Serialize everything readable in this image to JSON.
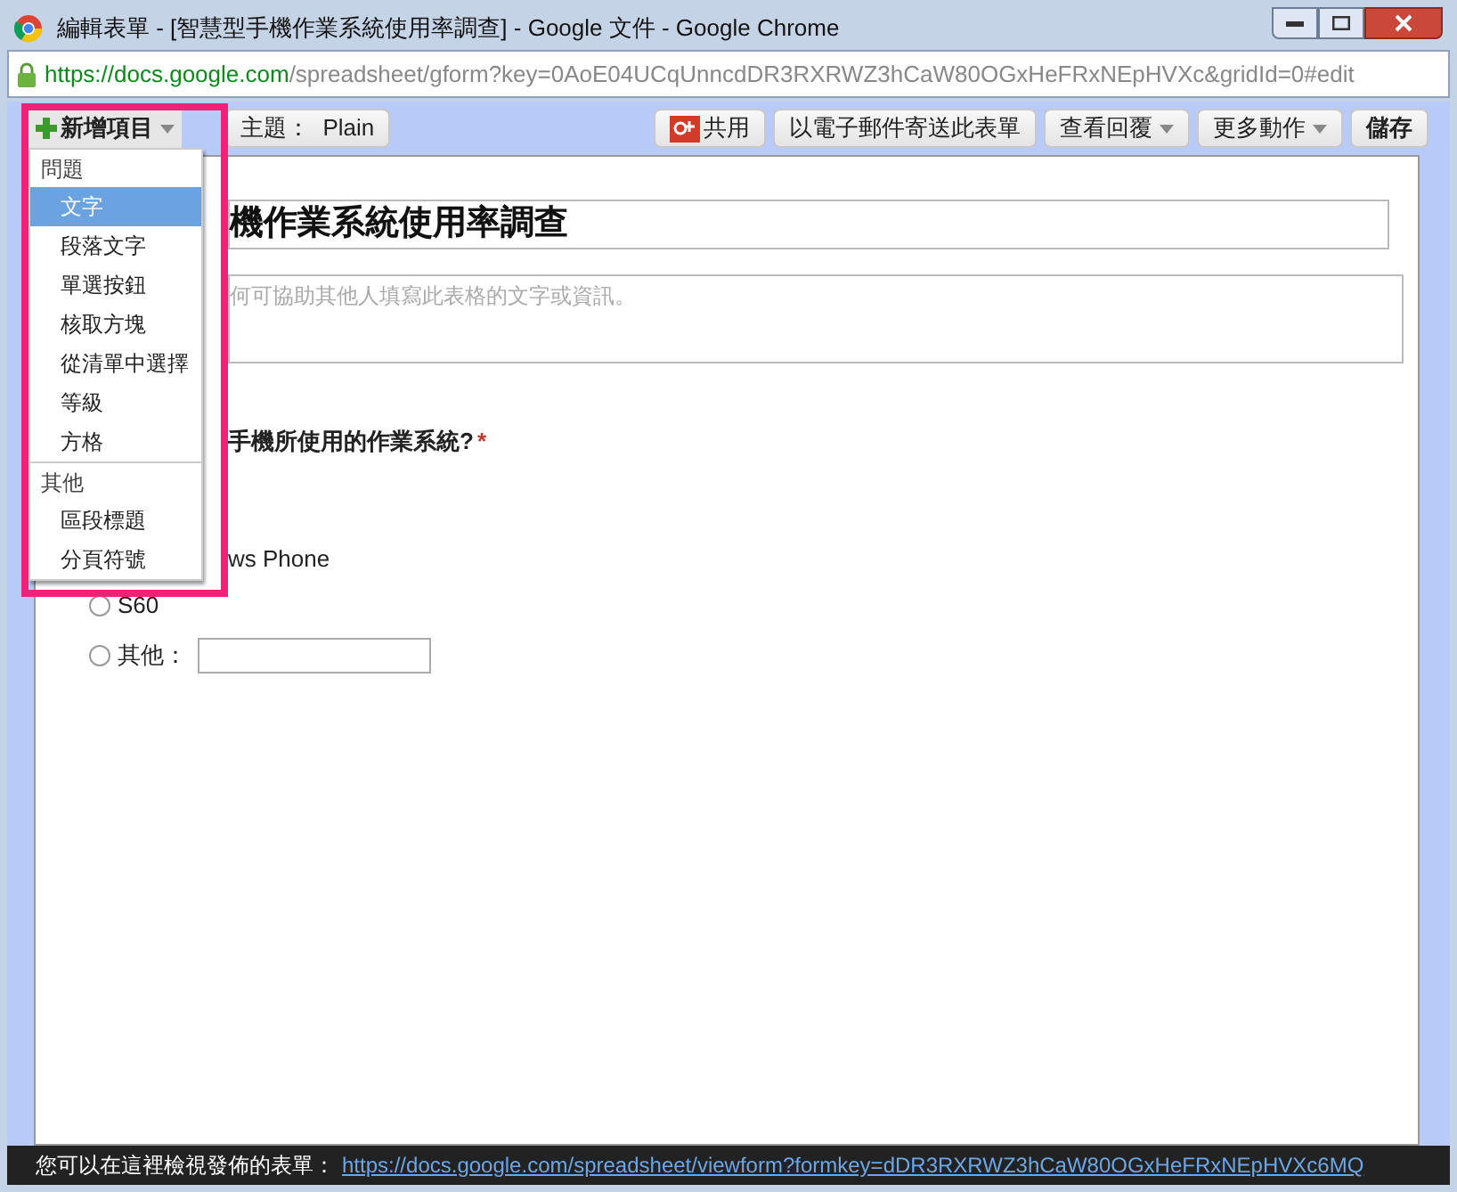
{
  "window": {
    "title": "編輯表單 - [智慧型手機作業系統使用率調查] - Google 文件 - Google Chrome"
  },
  "address_bar": {
    "scheme_host": "https://docs.google.com",
    "path": "/spreadsheet/gform?key=0AoE04UCqUnncdDR3RXRWZ3hCaW80OGxHeFRxNEpHVXc&gridId=0#edit"
  },
  "toolbar": {
    "add_item": "新增項目",
    "theme": "主題：  Plain",
    "share": "共用",
    "email": "以電子郵件寄送此表單",
    "responses": "查看回覆",
    "more": "更多動作",
    "save": "儲存"
  },
  "form": {
    "title": "機作業系統使用率調查",
    "description_placeholder": "何可協助其他人填寫此表格的文字或資訊。",
    "question": "手機所使用的作業系統?",
    "required_mark": "*",
    "options": [
      {
        "kind": "text",
        "label": "ws Phone"
      },
      {
        "kind": "radio",
        "label": "S60",
        "selected": false
      },
      {
        "kind": "other",
        "label": "其他：",
        "selected": false
      }
    ]
  },
  "add_menu": {
    "sections": [
      {
        "header": "問題",
        "items": [
          {
            "label": "文字",
            "selected": true
          },
          {
            "label": "段落文字",
            "selected": false
          },
          {
            "label": "單選按鈕",
            "selected": false
          },
          {
            "label": "核取方塊",
            "selected": false
          },
          {
            "label": "從清單中選擇",
            "selected": false
          },
          {
            "label": "等級",
            "selected": false
          },
          {
            "label": "方格",
            "selected": false
          }
        ]
      },
      {
        "header": "其他",
        "items": [
          {
            "label": "區段標題",
            "selected": false
          },
          {
            "label": "分頁符號",
            "selected": false
          }
        ]
      }
    ]
  },
  "footer": {
    "text": "您可以在這裡檢視發佈的表單：",
    "link": "https://docs.google.com/spreadsheet/viewform?formkey=dDR3RXRWZ3hCaW80OGxHeFRxNEpHVXc6MQ"
  }
}
